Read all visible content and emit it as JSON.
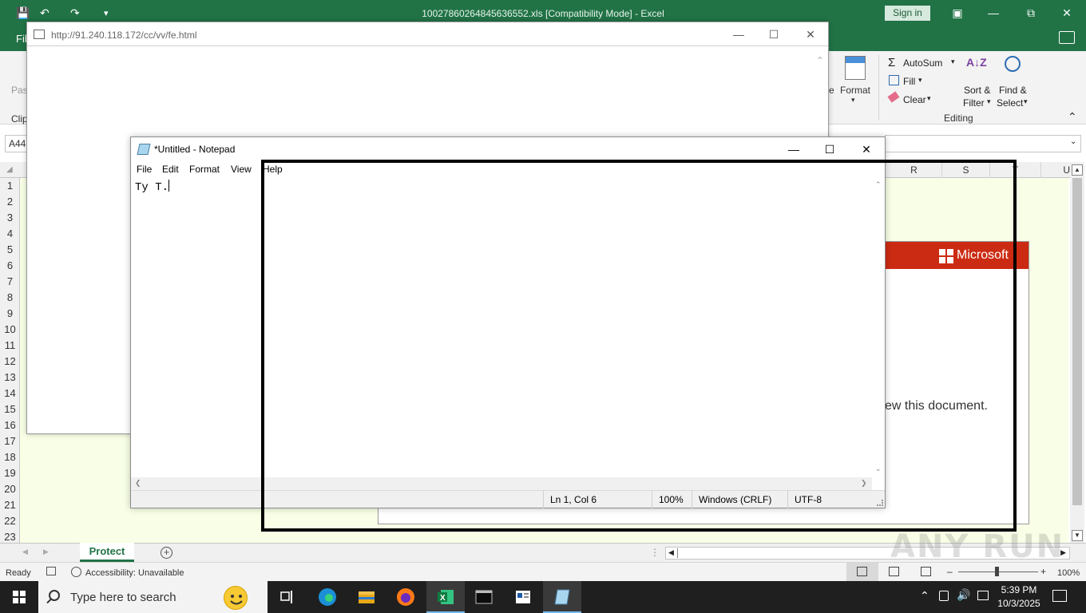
{
  "excel": {
    "title": "10027860264845636552.xls  [Compatibility Mode]  -  Excel",
    "signin_label": "Sign in",
    "file_tab_partial": "Fil",
    "ribbon": {
      "paste_partial": "Pas",
      "clipboard_partial": "Clip",
      "format_partial_prefix": "e",
      "format_label": "Format",
      "autosum_label": "AutoSum",
      "fill_label": "Fill",
      "clear_label": "Clear",
      "sort_filter_line1": "Sort &",
      "sort_filter_line2": "Filter",
      "find_select_line1": "Find &",
      "find_select_line2": "Select",
      "editing_group": "Editing"
    },
    "name_box": "A44",
    "column_headers": [
      "R",
      "S",
      "T",
      "U"
    ],
    "row_headers": [
      "1",
      "2",
      "3",
      "4",
      "5",
      "6",
      "7",
      "8",
      "9",
      "10",
      "11",
      "12",
      "13",
      "14",
      "15",
      "16",
      "17",
      "18",
      "19",
      "20",
      "21",
      "22",
      "23"
    ],
    "embedded_doc": {
      "brand": "Microsoft",
      "message_partial": "ew this document."
    },
    "sheet_tab": "Protect",
    "status": {
      "ready": "Ready",
      "accessibility": "Accessibility: Unavailable",
      "zoom": "100%"
    },
    "watermark": "ANY RUN"
  },
  "browser": {
    "url": "http://91.240.118.172/cc/vv/fe.html"
  },
  "notepad": {
    "title": "*Untitled - Notepad",
    "menu": [
      "File",
      "Edit",
      "Format",
      "View",
      "Help"
    ],
    "text": "Ty T.",
    "status": {
      "position": "Ln 1, Col 6",
      "zoom": "100%",
      "line_endings": "Windows (CRLF)",
      "encoding": "UTF-8"
    }
  },
  "taskbar": {
    "search_placeholder": "Type here to search",
    "apps": [
      "task-view",
      "edge",
      "file-explorer",
      "firefox",
      "excel",
      "cmd",
      "news",
      "notepad"
    ],
    "time": "5:39 PM",
    "date": "10/3/2025"
  },
  "colors": {
    "excel_green": "#217346",
    "grid_bg": "#f8ffe6",
    "ms_red": "#cc2b13",
    "taskbar": "#1f1f1f"
  }
}
